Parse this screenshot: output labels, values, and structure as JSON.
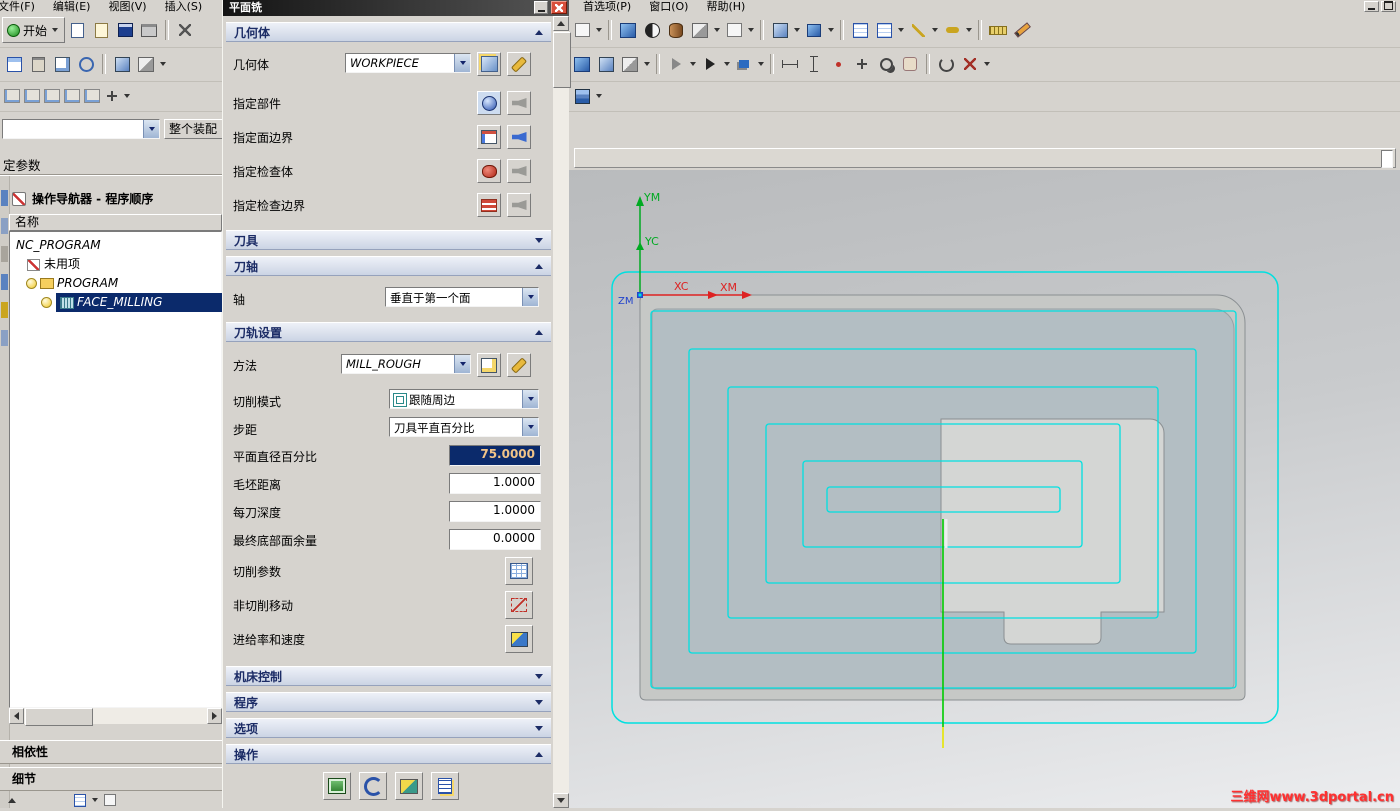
{
  "colors": {
    "selection_bg": "#0b2a6b",
    "selected_value_text": "#f2c488",
    "toolpath_cyan": "#00e0e0",
    "axis_green": "#00aa22",
    "axis_red": "#dd2222",
    "axis_blue": "#2244cc",
    "watermark_red": "#ff3030",
    "dialog_header_text": "#1c2c66"
  },
  "menubar": {
    "left": [
      {
        "label": "文件(F)"
      },
      {
        "label": "编辑(E)"
      },
      {
        "label": "视图(V)"
      },
      {
        "label": "插入(S)"
      }
    ],
    "right": [
      {
        "label": "首选项(P)"
      },
      {
        "label": "窗口(O)"
      },
      {
        "label": "帮助(H)"
      }
    ]
  },
  "left_panel": {
    "start_button": "开始",
    "assembly_button": "整个装配",
    "param_label": "定参数",
    "navigator_title": "操作导航器 - 程序顺序",
    "column_header": "名称",
    "tree": [
      {
        "label": "NC_PROGRAM"
      },
      {
        "label": "未用项"
      },
      {
        "label": "PROGRAM"
      },
      {
        "label": "FACE_MILLING"
      }
    ],
    "dependencies_label": "相依性",
    "details_label": "细节"
  },
  "dialog": {
    "title": "平面铣",
    "geometry_header": "几何体",
    "geometry_label": "几何体",
    "geometry_value": "WORKPIECE",
    "specify_part_label": "指定部件",
    "specify_face_boundary_label": "指定面边界",
    "specify_check_body_label": "指定检查体",
    "specify_check_boundary_label": "指定检查边界",
    "tool_header": "刀具",
    "tool_axis_header": "刀轴",
    "axis_label": "轴",
    "axis_value": "垂直于第一个面",
    "path_settings_header": "刀轨设置",
    "method_label": "方法",
    "method_value": "MILL_ROUGH",
    "cut_pattern_label": "切削模式",
    "cut_pattern_value": "跟随周边",
    "stepover_label": "步距",
    "stepover_value": "刀具平直百分比",
    "flat_diameter_percent_label": "平面直径百分比",
    "flat_diameter_percent_value": "75.0000",
    "blank_distance_label": "毛坯距离",
    "blank_distance_value": "1.0000",
    "depth_per_cut_label": "每刀深度",
    "depth_per_cut_value": "1.0000",
    "final_floor_stock_label": "最终底部面余量",
    "final_floor_stock_value": "0.0000",
    "cutting_parameters_label": "切削参数",
    "non_cutting_moves_label": "非切削移动",
    "feeds_speeds_label": "进给率和速度",
    "machine_control_header": "机床控制",
    "program_header": "程序",
    "options_header": "选项",
    "actions_header": "操作"
  },
  "viewport": {
    "axes": {
      "ym": "YM",
      "yc": "YC",
      "xc": "XC",
      "xm": "XM",
      "zm": "ZM"
    },
    "watermark": "三维网www.3dportal.cn"
  }
}
